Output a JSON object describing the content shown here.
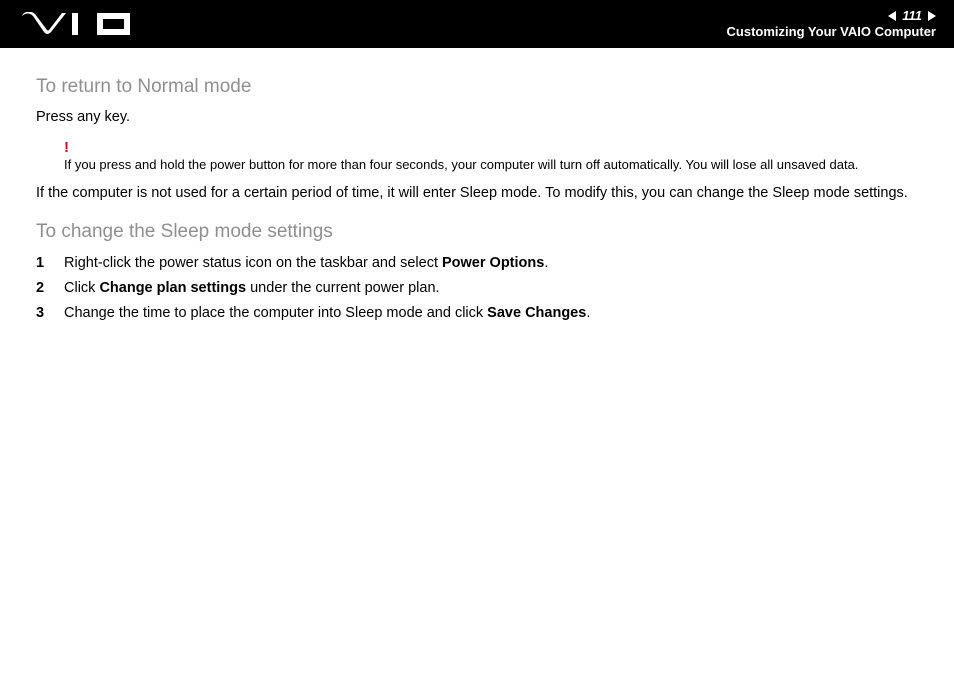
{
  "header": {
    "page_number": "111",
    "section": "Customizing Your VAIO Computer"
  },
  "section1": {
    "title": "To return to Normal mode",
    "body": "Press any key.",
    "note_mark": "!",
    "note": "If you press and hold the power button for more than four seconds, your computer will turn off automatically. You will lose all unsaved data.",
    "body2": "If the computer is not used for a certain period of time, it will enter Sleep mode. To modify this, you can change the Sleep mode settings."
  },
  "section2": {
    "title": "To change the Sleep mode settings",
    "steps": [
      {
        "n": "1",
        "pre": "Right-click the power status icon on the taskbar and select ",
        "bold": "Power Options",
        "post": "."
      },
      {
        "n": "2",
        "pre": "Click ",
        "bold": "Change plan settings",
        "post": " under the current power plan."
      },
      {
        "n": "3",
        "pre": "Change the time to place the computer into Sleep mode and click ",
        "bold": "Save Changes",
        "post": "."
      }
    ]
  }
}
